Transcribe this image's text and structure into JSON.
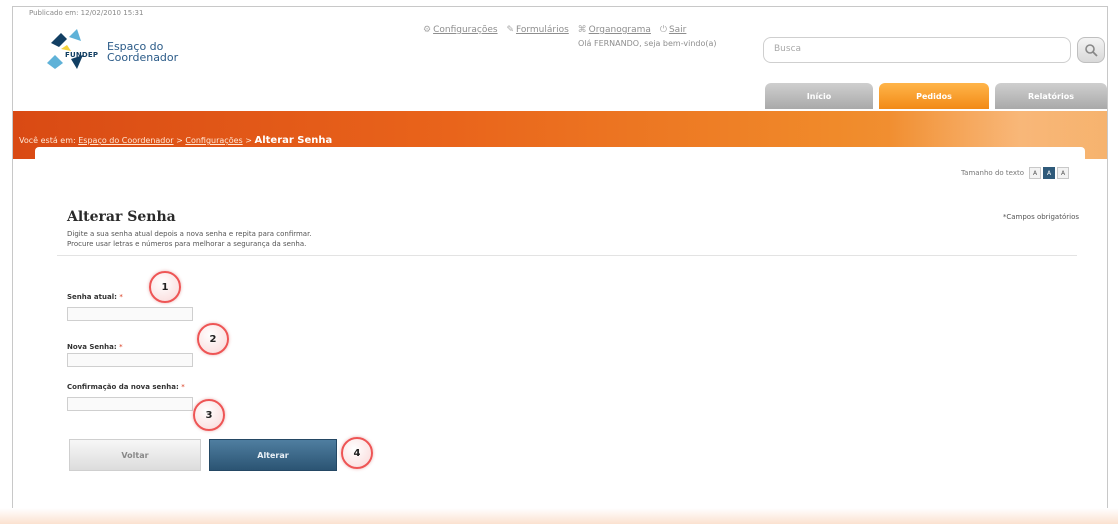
{
  "header": {
    "pub_date": "Publicado em: 12/02/2010 15:31",
    "logo_brand": "FUNDEP",
    "app_title": "Espaço do Coordenador",
    "top_links": [
      {
        "icon": "gear-icon",
        "label": "Configurações"
      },
      {
        "icon": "form-icon",
        "label": "Formulários"
      },
      {
        "icon": "org-icon",
        "label": "Organograma"
      },
      {
        "icon": "exit-icon",
        "label": "Sair"
      }
    ],
    "greeting": "Olá FERNANDO, seja bem-vindo(a)",
    "search_placeholder": "Busca"
  },
  "nav": {
    "tabs": [
      "Início",
      "Pedidos",
      "Relatórios"
    ]
  },
  "breadcrumb": {
    "prefix": "Você está em:",
    "items": [
      "Espaço do Coordenador",
      "Configurações"
    ],
    "current": "Alterar Senha"
  },
  "text_size": {
    "label": "Tamanho do texto",
    "options": [
      "A",
      "A",
      "A"
    ]
  },
  "page": {
    "title": "Alterar Senha",
    "desc_line1": "Digite a sua senha atual depois a nova senha e repita para confirmar.",
    "desc_line2": "Procure usar letras e números para melhorar a segurança da senha.",
    "required_note": "*Campos obrigatórios"
  },
  "form": {
    "current_password_label": "Senha atual:",
    "new_password_label": "Nova Senha:",
    "confirm_password_label": "Confirmação da nova senha:",
    "required_mark": "*"
  },
  "buttons": {
    "back": "Voltar",
    "change": "Alterar"
  },
  "badges": [
    "1",
    "2",
    "3",
    "4"
  ],
  "colors": {
    "banner_orange": "#e9641b",
    "tab_active": "#f28a16",
    "primary_button": "#2b5473",
    "badge_border": "#e55555"
  }
}
